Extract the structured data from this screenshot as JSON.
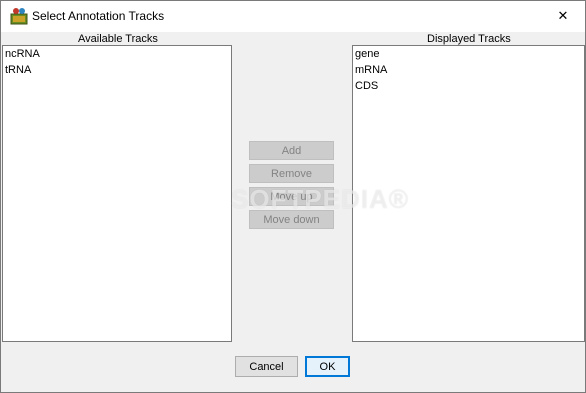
{
  "window": {
    "title": "Select Annotation Tracks",
    "close_symbol": "✕"
  },
  "available": {
    "label": "Available Tracks",
    "items": [
      "ncRNA",
      "tRNA"
    ]
  },
  "displayed": {
    "label": "Displayed Tracks",
    "items": [
      "gene",
      "mRNA",
      "CDS"
    ]
  },
  "actions": {
    "add": "Add",
    "remove": "Remove",
    "move_up": "Move up",
    "move_down": "Move down"
  },
  "dialog": {
    "cancel": "Cancel",
    "ok": "OK"
  },
  "watermark": "SOFTPEDIA®",
  "colors": {
    "disabled_button_bg": "#cccccc",
    "disabled_text": "#838383",
    "default_button_border": "#0078d7"
  }
}
